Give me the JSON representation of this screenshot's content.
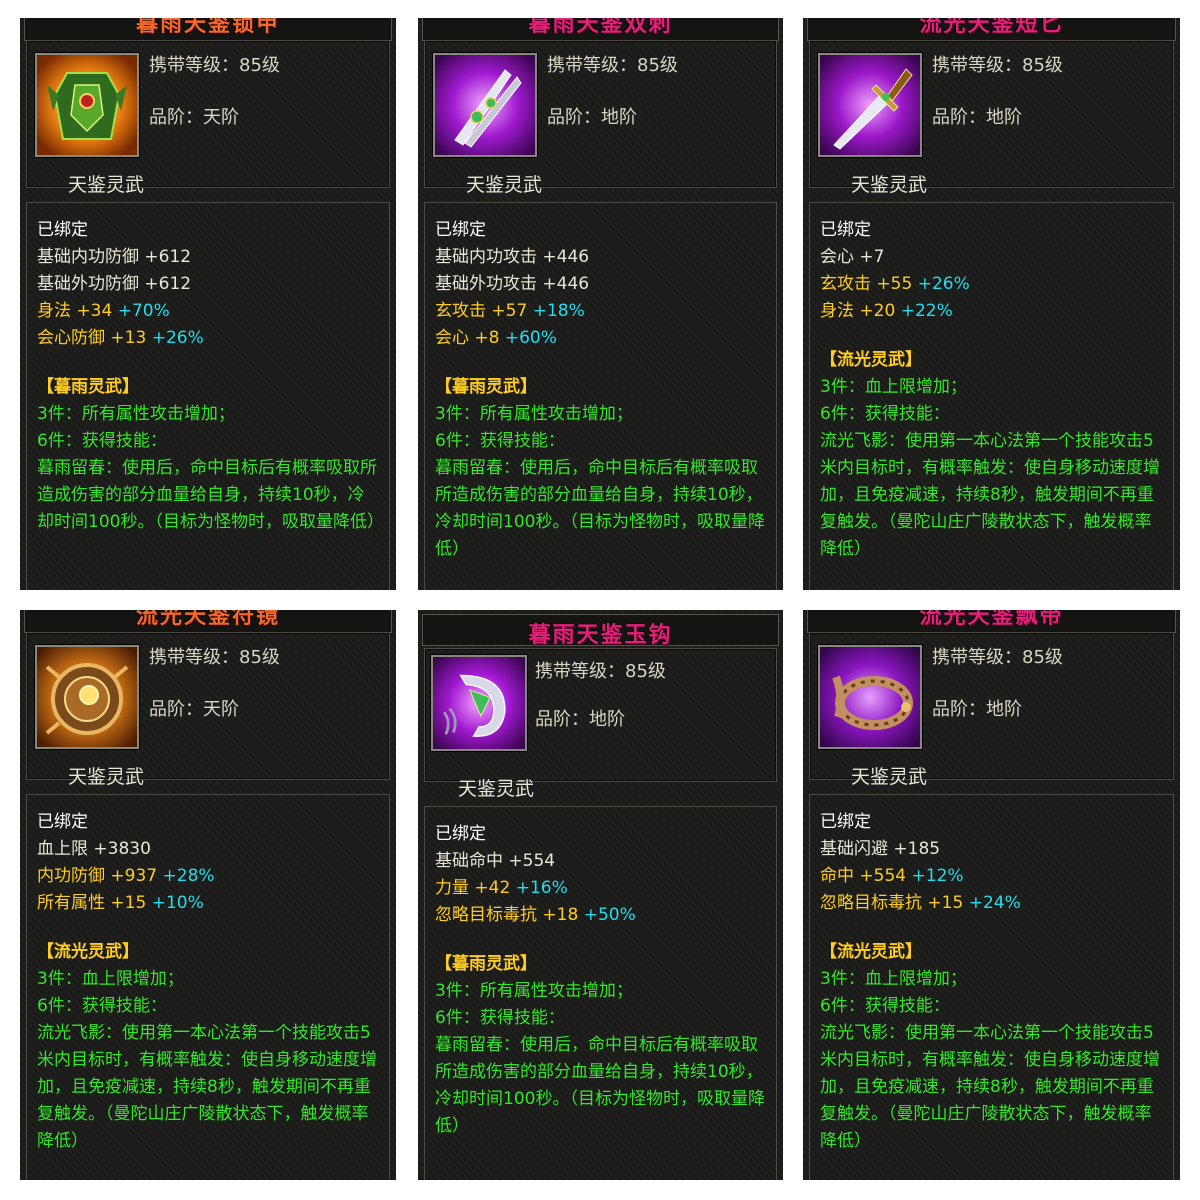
{
  "items": [
    {
      "title": "暮雨天鉴锁甲",
      "level": "携带等级：85级",
      "grade": "品阶：天阶",
      "category": "天鉴灵武",
      "bound": "已绑定",
      "stats": [
        {
          "name": "基础内功防御",
          "value": "+612",
          "bonus": ""
        },
        {
          "name": "基础外功防御",
          "value": "+612",
          "bonus": ""
        },
        {
          "name": "身法",
          "value": "+34",
          "bonus": "+70%"
        },
        {
          "name": "会心防御",
          "value": "+13",
          "bonus": "+26%"
        }
      ],
      "set_name": "【暮雨灵武】",
      "set3": "3件：所有属性攻击增加；",
      "set6": "6件：获得技能：",
      "skill": "暮雨留春：使用后，命中目标后有概率吸取所造成伤害的部分血量给自身，持续10秒，冷却时间100秒。（目标为怪物时，吸取量降低）"
    },
    {
      "title": "暮雨天鉴双刺",
      "level": "携带等级：85级",
      "grade": "品阶：地阶",
      "category": "天鉴灵武",
      "bound": "已绑定",
      "stats": [
        {
          "name": "基础内功攻击",
          "value": "+446",
          "bonus": ""
        },
        {
          "name": "基础外功攻击",
          "value": "+446",
          "bonus": ""
        },
        {
          "name": "玄攻击",
          "value": "+57",
          "bonus": "+18%"
        },
        {
          "name": "会心",
          "value": "+8",
          "bonus": "+60%"
        }
      ],
      "set_name": "【暮雨灵武】",
      "set3": "3件：所有属性攻击增加；",
      "set6": "6件：获得技能：",
      "skill": "暮雨留春：使用后，命中目标后有概率吸取所造成伤害的部分血量给自身，持续10秒，冷却时间100秒。（目标为怪物时，吸取量降低）"
    },
    {
      "title": "流光天鉴短匕",
      "level": "携带等级：85级",
      "grade": "品阶：地阶",
      "category": "天鉴灵武",
      "bound": "已绑定",
      "stats": [
        {
          "name": "会心",
          "value": "+7",
          "bonus": ""
        },
        {
          "name": "玄攻击",
          "value": "+55",
          "bonus": "+26%"
        },
        {
          "name": "身法",
          "value": "+20",
          "bonus": "+22%"
        }
      ],
      "set_name": "【流光灵武】",
      "set3": "3件：血上限增加；",
      "set6": "6件：获得技能：",
      "skill": "流光飞影：使用第一本心法第一个技能攻击5米内目标时，有概率触发：使自身移动速度增加，且免疫减速，持续8秒，触发期间不再重复触发。（曼陀山庄广陵散状态下，触发概率降低）"
    },
    {
      "title": "流光天鉴符镜",
      "level": "携带等级：85级",
      "grade": "品阶：天阶",
      "category": "天鉴灵武",
      "bound": "已绑定",
      "stats": [
        {
          "name": "血上限",
          "value": "+3830",
          "bonus": ""
        },
        {
          "name": "内功防御",
          "value": "+937",
          "bonus": "+28%"
        },
        {
          "name": "所有属性",
          "value": "+15",
          "bonus": "+10%"
        }
      ],
      "set_name": "【流光灵武】",
      "set3": "3件：血上限增加；",
      "set6": "6件：获得技能：",
      "skill": "流光飞影：使用第一本心法第一个技能攻击5米内目标时，有概率触发：使自身移动速度增加，且免疫减速，持续8秒，触发期间不再重复触发。（曼陀山庄广陵散状态下，触发概率降低）"
    },
    {
      "title": "暮雨天鉴玉钩",
      "level": "携带等级：85级",
      "grade": "品阶：地阶",
      "category": "天鉴灵武",
      "bound": "已绑定",
      "stats": [
        {
          "name": "基础命中",
          "value": "+554",
          "bonus": ""
        },
        {
          "name": "力量",
          "value": "+42",
          "bonus": "+16%"
        },
        {
          "name": "忽略目标毒抗",
          "value": "+18",
          "bonus": "+50%"
        }
      ],
      "set_name": "【暮雨灵武】",
      "set3": "3件：所有属性攻击增加；",
      "set6": "6件：获得技能：",
      "skill": "暮雨留春：使用后，命中目标后有概率吸取所造成伤害的部分血量给自身，持续10秒，冷却时间100秒。（目标为怪物时，吸取量降低）"
    },
    {
      "title": "流光天鉴飘带",
      "level": "携带等级：85级",
      "grade": "品阶：地阶",
      "category": "天鉴灵武",
      "bound": "已绑定",
      "stats": [
        {
          "name": "基础闪避",
          "value": "+185",
          "bonus": ""
        },
        {
          "name": "命中",
          "value": "+554",
          "bonus": "+12%"
        },
        {
          "name": "忽略目标毒抗",
          "value": "+15",
          "bonus": "+24%"
        }
      ],
      "set_name": "【流光灵武】",
      "set3": "3件：血上限增加；",
      "set6": "6件：获得技能：",
      "skill": "流光飞影：使用第一本心法第一个技能攻击5米内目标时，有概率触发：使自身移动速度增加，且免疫减速，持续8秒，触发期间不再重复触发。（曼陀山庄广陵散状态下，触发概率降低）"
    }
  ],
  "colors": {
    "title_pink": "#e4207a",
    "title_orange": "#f4692a",
    "stat_yellow": "#ffcc22",
    "bonus_cyan": "#22ddee",
    "effect_green": "#33e62a"
  }
}
